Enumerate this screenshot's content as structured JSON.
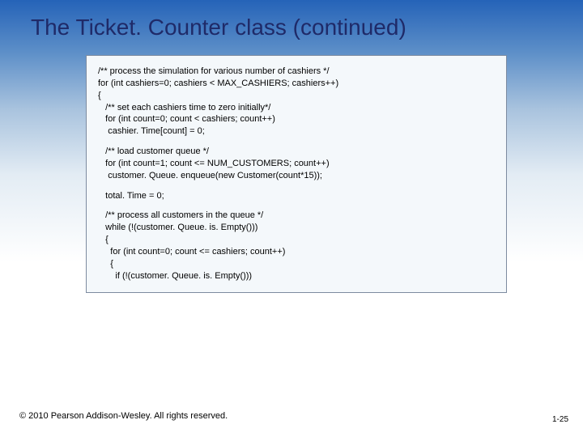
{
  "title": "The Ticket. Counter class (continued)",
  "code": {
    "p1": "/** process the simulation for various number of cashiers */\nfor (int cashiers=0; cashiers < MAX_CASHIERS; cashiers++)\n{\n   /** set each cashiers time to zero initially*/\n   for (int count=0; count < cashiers; count++)\n    cashier. Time[count] = 0;",
    "p2": "   /** load customer queue */\n   for (int count=1; count <= NUM_CUSTOMERS; count++)\n    customer. Queue. enqueue(new Customer(count*15));",
    "p3": "   total. Time = 0;",
    "p4": "   /** process all customers in the queue */\n   while (!(customer. Queue. is. Empty()))\n   {\n     for (int count=0; count <= cashiers; count++)\n     {\n       if (!(customer. Queue. is. Empty()))"
  },
  "footer": {
    "copyright": "© 2010 Pearson Addison-Wesley. All rights reserved.",
    "page": "1-25"
  }
}
